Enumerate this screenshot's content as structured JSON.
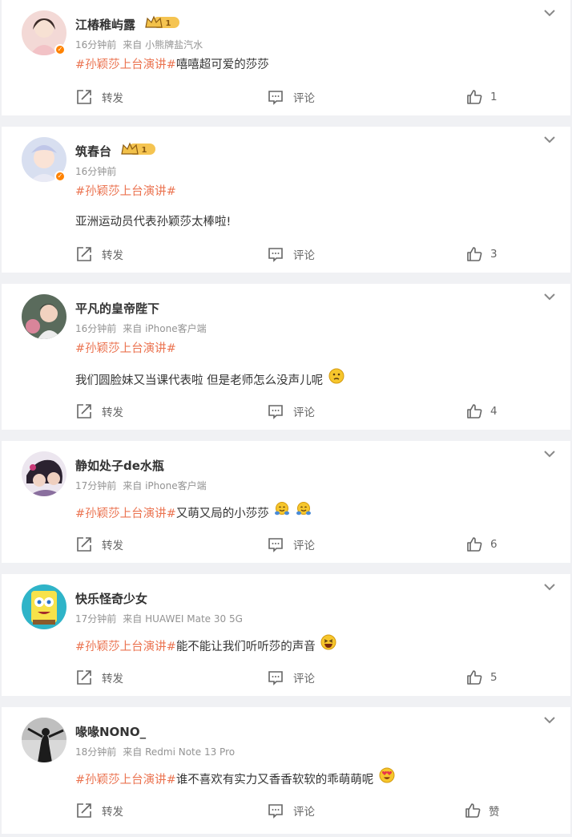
{
  "hashtag": "#孙颖莎上台演讲#",
  "actions": {
    "forward": "转发",
    "comment": "评论"
  },
  "comments": [
    {
      "name": "江椿稚屿露",
      "crown_level": "1",
      "verified": "true",
      "time": "16分钟前",
      "source": "来自 小熊牌盐汽水",
      "text_line1": "嘻嘻超可爱的莎莎",
      "text_line2": "",
      "likes": "1",
      "emojis": []
    },
    {
      "name": "筑春台",
      "crown_level": "1",
      "verified": "true",
      "time": "16分钟前",
      "source": "",
      "text_line1": "",
      "text_line2": "亚洲运动员代表孙颖莎太棒啦!",
      "likes": "3",
      "emojis": []
    },
    {
      "name": "平凡的皇帝陛下",
      "crown_level": "",
      "verified": "false",
      "time": "16分钟前",
      "source": "来自 iPhone客户端",
      "text_line1": "",
      "text_line2": "我们圆脸妹又当课代表啦 但是老师怎么没声儿呢",
      "likes": "4",
      "emojis": [
        "pouting-face"
      ]
    },
    {
      "name": "静如处子de水瓶",
      "crown_level": "",
      "verified": "false",
      "time": "17分钟前",
      "source": "来自 iPhone客户端",
      "text_line1": "又萌又局的小莎莎",
      "text_line2": "",
      "likes": "6",
      "emojis": [
        "hugging-face",
        "hugging-face"
      ]
    },
    {
      "name": "快乐怪奇少女",
      "crown_level": "",
      "verified": "false",
      "time": "17分钟前",
      "source": "来自 HUAWEI Mate 30 5G",
      "text_line1": "能不能让我们听听莎的声音",
      "text_line2": "",
      "likes": "5",
      "emojis": [
        "laughing-face"
      ]
    },
    {
      "name": "喙喙NONO_",
      "crown_level": "",
      "verified": "false",
      "time": "18分钟前",
      "source": "来自 Redmi Note 13 Pro",
      "text_line1": "谁不喜欢有实力又香香软软的乖萌萌呢",
      "text_line2": "",
      "likes": "赞",
      "emojis": [
        "heart-eyes-face"
      ]
    }
  ],
  "colors": {
    "accent": "#eb7350",
    "meta": "#939393",
    "background": "#f0f1f4",
    "verified": "#ff8200"
  }
}
